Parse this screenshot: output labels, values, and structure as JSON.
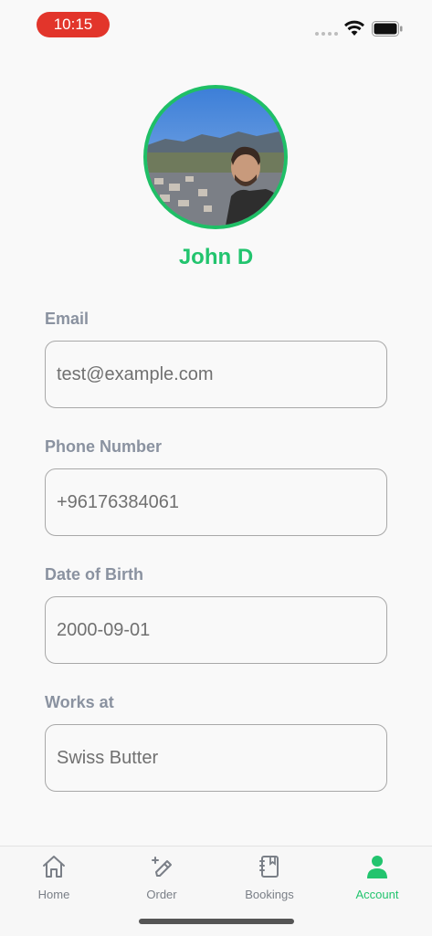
{
  "status_bar": {
    "time": "10:15"
  },
  "profile": {
    "name": "John D"
  },
  "fields": [
    {
      "label": "Email",
      "value": "test@example.com"
    },
    {
      "label": "Phone Number",
      "value": "+96176384061"
    },
    {
      "label": "Date of Birth",
      "value": "2000-09-01"
    },
    {
      "label": "Works at",
      "value": "Swiss Butter"
    }
  ],
  "tabs": [
    {
      "label": "Home",
      "icon": "home-icon"
    },
    {
      "label": "Order",
      "icon": "pencil-plus-icon"
    },
    {
      "label": "Bookings",
      "icon": "notebook-icon"
    },
    {
      "label": "Account",
      "icon": "person-icon",
      "active": true
    }
  ],
  "colors": {
    "accent": "#22c46e",
    "status_pill": "#e2352b",
    "label": "#8a92a0",
    "inactive_tab": "#7a7f87"
  }
}
